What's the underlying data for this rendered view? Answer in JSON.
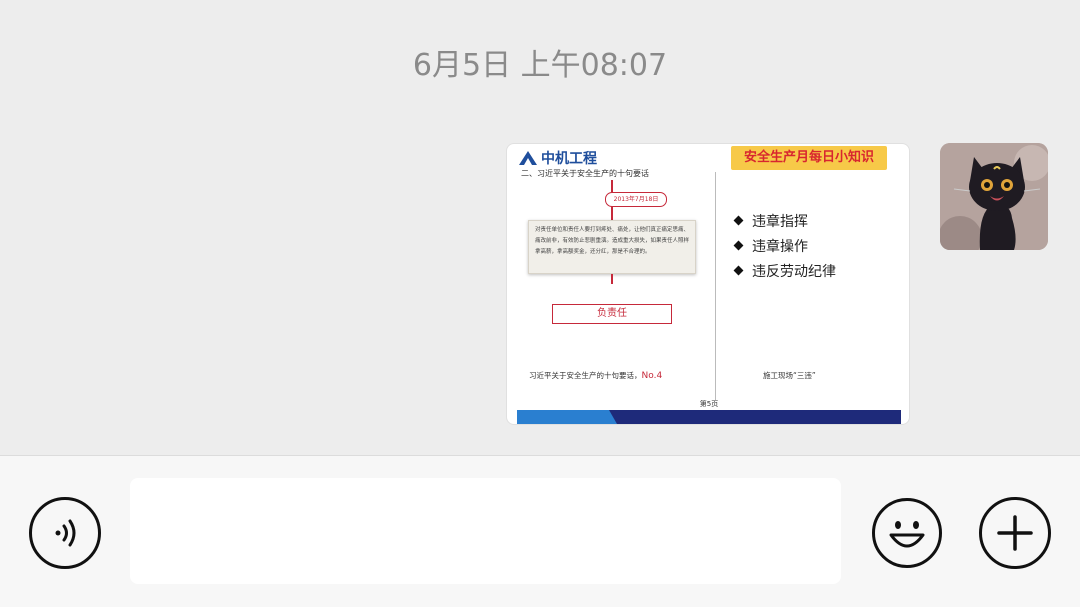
{
  "chat": {
    "timestamp": "6月5日 上午08:07"
  },
  "message": {
    "type": "image",
    "slide": {
      "logo_text": "中机工程",
      "subtitle": "二、习近平关于安全生产的十句要话",
      "date_label": "2013年7月18日",
      "quote": "对责任单位和责任人要打到疼处、痛处，让他们真正痛定思痛、痛改前非，有效防止悲剧重演。造成重大损失，如果责任人照样拿高薪，拿高额奖金，还分红，那是不合理的。",
      "responsibility_label": "负责任",
      "caption_left": "习近平关于安全生产的十句要话，",
      "caption_left_no": "No.4",
      "banner_title": "安全生产月每日小知识",
      "bullets": [
        "违章指挥",
        "违章操作",
        "违反劳动纪律"
      ],
      "caption_right": "施工现场“三违”",
      "page_label": "第5页"
    }
  },
  "input": {
    "value": "",
    "voice_icon": "voice-icon",
    "emoji_icon": "emoji-icon",
    "plus_icon": "plus-icon"
  }
}
